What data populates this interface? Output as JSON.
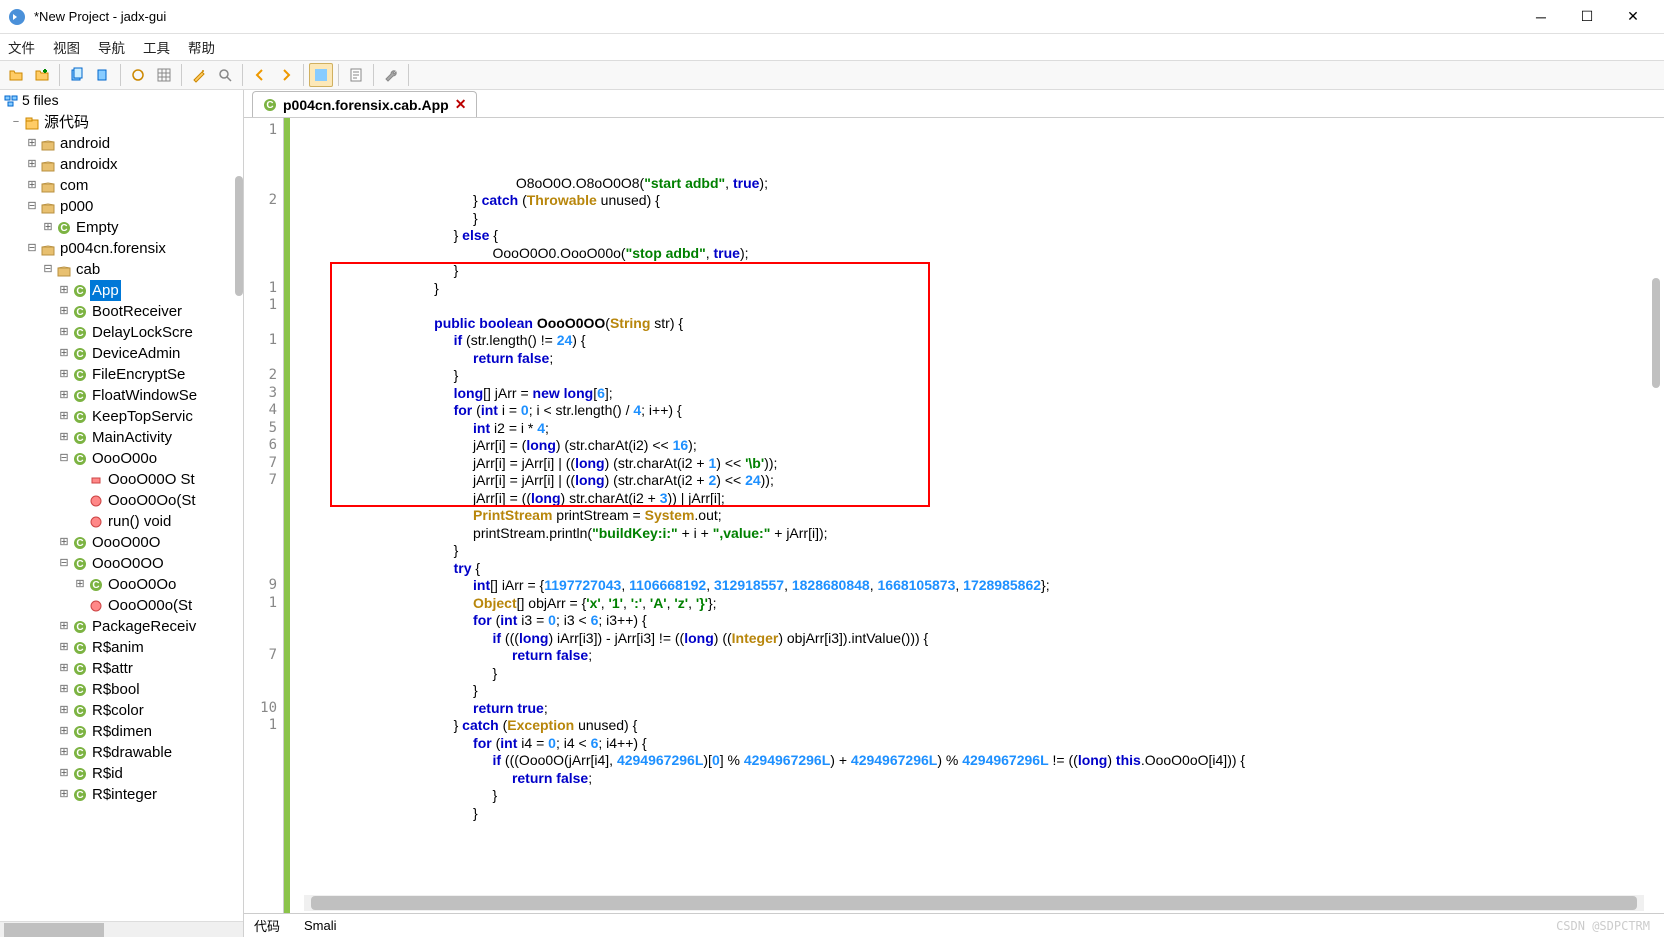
{
  "window": {
    "title": "*New Project - jadx-gui"
  },
  "menus": [
    "文件",
    "视图",
    "导航",
    "工具",
    "帮助"
  ],
  "side": {
    "root": "5 files",
    "srcroot": "源代码",
    "nodes": [
      {
        "d": 1,
        "e": "+",
        "t": "pkg",
        "l": "android"
      },
      {
        "d": 1,
        "e": "+",
        "t": "pkg",
        "l": "androidx"
      },
      {
        "d": 1,
        "e": "+",
        "t": "pkg",
        "l": "com"
      },
      {
        "d": 1,
        "e": "-",
        "t": "pkg",
        "l": "p000"
      },
      {
        "d": 2,
        "e": "+",
        "t": "cls",
        "l": "Empty"
      },
      {
        "d": 1,
        "e": "-",
        "t": "pkg",
        "l": "p004cn.forensix"
      },
      {
        "d": 2,
        "e": "-",
        "t": "pkg",
        "l": "cab"
      },
      {
        "d": 3,
        "e": "+",
        "t": "cls",
        "l": "App",
        "sel": true
      },
      {
        "d": 3,
        "e": "+",
        "t": "cls",
        "l": "BootReceiver"
      },
      {
        "d": 3,
        "e": "+",
        "t": "cls",
        "l": "DelayLockScre"
      },
      {
        "d": 3,
        "e": "+",
        "t": "cls",
        "l": "DeviceAdmin"
      },
      {
        "d": 3,
        "e": "+",
        "t": "cls",
        "l": "FileEncryptSe"
      },
      {
        "d": 3,
        "e": "+",
        "t": "cls",
        "l": "FloatWindowSe"
      },
      {
        "d": 3,
        "e": "+",
        "t": "cls",
        "l": "KeepTopServic"
      },
      {
        "d": 3,
        "e": "+",
        "t": "cls",
        "l": "MainActivity"
      },
      {
        "d": 3,
        "e": "-",
        "t": "cls",
        "l": "OooO00o"
      },
      {
        "d": 4,
        "e": " ",
        "t": "fld",
        "l": "OooO00O St"
      },
      {
        "d": 4,
        "e": " ",
        "t": "mth",
        "l": "OooO0Oo(St"
      },
      {
        "d": 4,
        "e": " ",
        "t": "mth",
        "l": "run() void"
      },
      {
        "d": 3,
        "e": "+",
        "t": "cls",
        "l": "OooO00O"
      },
      {
        "d": 3,
        "e": "-",
        "t": "cls",
        "l": "OooO0OO"
      },
      {
        "d": 4,
        "e": "+",
        "t": "cls",
        "l": "OooO0Oo"
      },
      {
        "d": 4,
        "e": " ",
        "t": "mth",
        "l": "OooO00o(St"
      },
      {
        "d": 3,
        "e": "+",
        "t": "cls",
        "l": "PackageReceiv"
      },
      {
        "d": 3,
        "e": "+",
        "t": "cls",
        "l": "R$anim"
      },
      {
        "d": 3,
        "e": "+",
        "t": "cls",
        "l": "R$attr"
      },
      {
        "d": 3,
        "e": "+",
        "t": "cls",
        "l": "R$bool"
      },
      {
        "d": 3,
        "e": "+",
        "t": "cls",
        "l": "R$color"
      },
      {
        "d": 3,
        "e": "+",
        "t": "cls",
        "l": "R$dimen"
      },
      {
        "d": 3,
        "e": "+",
        "t": "cls",
        "l": "R$drawable"
      },
      {
        "d": 3,
        "e": "+",
        "t": "cls",
        "l": "R$id"
      },
      {
        "d": 3,
        "e": "+",
        "t": "cls",
        "l": "R$integer"
      }
    ]
  },
  "tab": {
    "label": "p004cn.forensix.cab.App"
  },
  "gutter": [
    "1",
    "",
    "",
    "",
    "2",
    "",
    "",
    "",
    "",
    "1",
    "1",
    "",
    "1",
    "",
    "2",
    "3",
    "4",
    "5",
    "6",
    "7",
    "7",
    "",
    "",
    "",
    "",
    "",
    "9",
    "1",
    "",
    "",
    "7",
    "",
    "",
    "10",
    "1",
    "",
    "",
    ""
  ],
  "code": [
    {
      "i": 11,
      "h": "            O8oO0O.O8oO0O8(<span class='st'>\"start adbd\"</span>, <span class='kw'>true</span>);"
    },
    {
      "i": 9,
      "h": "         } <span class='kw'>catch</span> (<span class='ty'>Throwable</span> unused) {"
    },
    {
      "i": 9,
      "h": "         }"
    },
    {
      "i": 8,
      "h": "        } <span class='kw'>else</span> {"
    },
    {
      "i": 10,
      "h": "          OooO0O0.OooO00o(<span class='st'>\"stop adbd\"</span>, <span class='kw'>true</span>);"
    },
    {
      "i": 8,
      "h": "        }"
    },
    {
      "i": 7,
      "h": "       }"
    },
    {
      "i": 0,
      "h": ""
    },
    {
      "i": 7,
      "h": "       <span class='kw'>public</span> <span class='kw'>boolean</span> <span class='mf'>OooO0OO</span>(<span class='ty'>String</span> str) {"
    },
    {
      "i": 8,
      "h": "        <span class='kw'>if</span> (str.length() != <span class='nm'>24</span>) {"
    },
    {
      "i": 9,
      "h": "         <span class='kw'>return</span> <span class='kw'>false</span>;"
    },
    {
      "i": 8,
      "h": "        }"
    },
    {
      "i": 8,
      "h": "        <span class='kw'>long</span>[] jArr = <span class='kw'>new</span> <span class='kw'>long</span>[<span class='nm'>6</span>];"
    },
    {
      "i": 8,
      "h": "        <span class='kw'>for</span> (<span class='kw'>int</span> i = <span class='nm'>0</span>; i &lt; str.length() / <span class='nm'>4</span>; i++) {"
    },
    {
      "i": 9,
      "h": "         <span class='kw'>int</span> i2 = i * <span class='nm'>4</span>;"
    },
    {
      "i": 9,
      "h": "         jArr[i] = (<span class='kw'>long</span>) (str.charAt(i2) &lt;&lt; <span class='nm'>16</span>);"
    },
    {
      "i": 9,
      "h": "         jArr[i] = jArr[i] | ((<span class='kw'>long</span>) (str.charAt(i2 + <span class='nm'>1</span>) &lt;&lt; <span class='st'>'\\b'</span>));"
    },
    {
      "i": 9,
      "h": "         jArr[i] = jArr[i] | ((<span class='kw'>long</span>) (str.charAt(i2 + <span class='nm'>2</span>) &lt;&lt; <span class='nm'>24</span>));"
    },
    {
      "i": 9,
      "h": "         jArr[i] = ((<span class='kw'>long</span>) str.charAt(i2 + <span class='nm'>3</span>)) | jArr[i];"
    },
    {
      "i": 9,
      "h": "         <span class='ty'>PrintStream</span> printStream = <span class='ty'>System</span>.out;"
    },
    {
      "i": 9,
      "h": "         printStream.println(<span class='st'>\"buildKey:i:\"</span> + i + <span class='st'>\",value:\"</span> + jArr[i]);"
    },
    {
      "i": 8,
      "h": "        }"
    },
    {
      "i": 8,
      "h": "        <span class='kw'>try</span> {"
    },
    {
      "i": 9,
      "h": "         <span class='kw'>int</span>[] iArr = {<span class='nm'>1197727043</span>, <span class='nm'>1106668192</span>, <span class='nm'>312918557</span>, <span class='nm'>1828680848</span>, <span class='nm'>1668105873</span>, <span class='nm'>1728985862</span>};"
    },
    {
      "i": 9,
      "h": "         <span class='ty'>Object</span>[] objArr = {<span class='st'>'x'</span>, <span class='st'>'1'</span>, <span class='st'>':'</span>, <span class='st'>'A'</span>, <span class='st'>'z'</span>, <span class='st'>'}'</span>};"
    },
    {
      "i": 9,
      "h": "         <span class='kw'>for</span> (<span class='kw'>int</span> i3 = <span class='nm'>0</span>; i3 &lt; <span class='nm'>6</span>; i3++) {"
    },
    {
      "i": 10,
      "h": "          <span class='kw'>if</span> (((<span class='kw'>long</span>) iArr[i3]) - jArr[i3] != ((<span class='kw'>long</span>) ((<span class='ty'>Integer</span>) objArr[i3]).intValue())) {"
    },
    {
      "i": 11,
      "h": "           <span class='kw'>return</span> <span class='kw'>false</span>;"
    },
    {
      "i": 10,
      "h": "          }"
    },
    {
      "i": 9,
      "h": "         }"
    },
    {
      "i": 9,
      "h": "         <span class='kw'>return</span> <span class='kw'>true</span>;"
    },
    {
      "i": 8,
      "h": "        } <span class='kw'>catch</span> (<span class='ty'>Exception</span> unused) {"
    },
    {
      "i": 9,
      "h": "         <span class='kw'>for</span> (<span class='kw'>int</span> i4 = <span class='nm'>0</span>; i4 &lt; <span class='nm'>6</span>; i4++) {"
    },
    {
      "i": 10,
      "h": "          <span class='kw'>if</span> (((Ooo0O(jArr[i4], <span class='nm'>4294967296L</span>)[<span class='nm'>0</span>] % <span class='nm'>4294967296L</span>) + <span class='nm'>4294967296L</span>) % <span class='nm'>4294967296L</span> != ((<span class='kw'>long</span>) <span class='kw'>this</span>.OooO0oO[i4])) {"
    },
    {
      "i": 11,
      "h": "           <span class='kw'>return</span> <span class='kw'>false</span>;"
    },
    {
      "i": 10,
      "h": "          }"
    },
    {
      "i": 9,
      "h": "         }"
    },
    {
      "i": 0,
      "h": ""
    }
  ],
  "bottom": {
    "code": "代码",
    "smali": "Smali"
  },
  "watermark": "CSDN @SDPCTRM"
}
